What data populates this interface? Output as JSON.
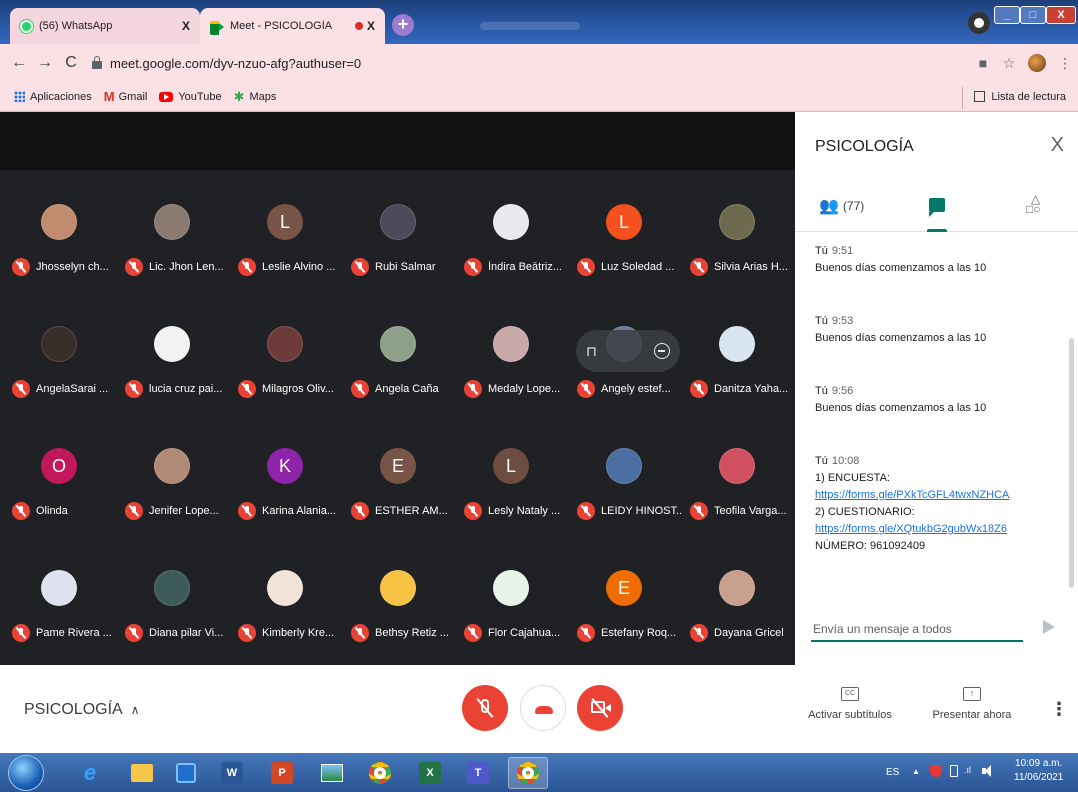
{
  "browser": {
    "tabs": [
      {
        "title": "(56) WhatsApp",
        "close": "X"
      },
      {
        "title": "Meet - PSICOLOGÍA",
        "close": "X"
      }
    ],
    "new_tab": "+",
    "url": "meet.google.com/dyv-nzuo-afg?authuser=0",
    "bookmarks": [
      "Aplicaciones",
      "Gmail",
      "YouTube",
      "Maps"
    ],
    "reading_list": "Lista de lectura",
    "window_buttons": {
      "minimize": "_",
      "maximize": "□",
      "close": "X"
    }
  },
  "participants": [
    {
      "name": "Jhosselyn ch...",
      "avatar": "",
      "color": "#c08b6e"
    },
    {
      "name": "Lic. Jhon Len...",
      "avatar": "",
      "color": "#8a7a70"
    },
    {
      "name": "Leslie Alvino ...",
      "avatar": "L",
      "color": "#795548"
    },
    {
      "name": "Rubi Salmar",
      "avatar": "",
      "color": "#4a4a5a"
    },
    {
      "name": "Índira Beātriz...",
      "avatar": "",
      "color": "#e8e8ee"
    },
    {
      "name": "Luz Soledad ...",
      "avatar": "L",
      "color": "#f4511e"
    },
    {
      "name": "Silvia Arias H...",
      "avatar": "",
      "color": "#6d6a4f"
    },
    {
      "name": "AngelaSarai ...",
      "avatar": "",
      "color": "#3a2e2a"
    },
    {
      "name": "lucia cruz pai...",
      "avatar": "",
      "color": "#f2f2f2"
    },
    {
      "name": "Milagros Oliv...",
      "avatar": "",
      "color": "#6e3b3b"
    },
    {
      "name": "Angela Caña",
      "avatar": "",
      "color": "#8fa08a"
    },
    {
      "name": "Medaly Lope...",
      "avatar": "",
      "color": "#c9a8a8"
    },
    {
      "name": "Angely estef...",
      "avatar": "",
      "color": "#6a7a9a"
    },
    {
      "name": "Danitza Yaha...",
      "avatar": "",
      "color": "#d8e4f0"
    },
    {
      "name": "Olinda",
      "avatar": "O",
      "color": "#c2185b"
    },
    {
      "name": "Jenifer Lope...",
      "avatar": "",
      "color": "#b08a74"
    },
    {
      "name": "Karina Alania...",
      "avatar": "K",
      "color": "#8e24aa"
    },
    {
      "name": "ESTHER AM...",
      "avatar": "E",
      "color": "#795548"
    },
    {
      "name": "Lesly Nataly ...",
      "avatar": "L",
      "color": "#6d4c41"
    },
    {
      "name": "LEIDY HINOST...",
      "avatar": "",
      "color": "#4a6fa0"
    },
    {
      "name": "Teofila Varga...",
      "avatar": "",
      "color": "#d05060"
    },
    {
      "name": "Pame Rivera ...",
      "avatar": "",
      "color": "#dde2ee"
    },
    {
      "name": "Diana pilar Vi...",
      "avatar": "",
      "color": "#3d5a5a"
    },
    {
      "name": "Kimberly Kre...",
      "avatar": "",
      "color": "#f2e3d8"
    },
    {
      "name": "Bethsy Retiz ...",
      "avatar": "",
      "color": "#f6c344"
    },
    {
      "name": "Flor Cajahua...",
      "avatar": "",
      "color": "#e8f4ea"
    },
    {
      "name": "Estefany Roq...",
      "avatar": "E",
      "color": "#ef6c00"
    },
    {
      "name": "Dayana Gricel",
      "avatar": "",
      "color": "#c9a08e"
    }
  ],
  "panel": {
    "title": "PSICOLOGÍA",
    "close": "X",
    "people_count": "(77)",
    "messages": [
      {
        "sender": "Tú",
        "time": "9:51",
        "lines": [
          "Buenos días comenzamos a las 10"
        ]
      },
      {
        "sender": "Tú",
        "time": "9:53",
        "lines": [
          "Buenos días comenzamos a las 10"
        ]
      },
      {
        "sender": "Tú",
        "time": "9:56",
        "lines": [
          "Buenos días comenzamos a las 10"
        ]
      },
      {
        "sender": "Tú",
        "time": "10:08",
        "lines": [
          "1)   ENCUESTA:",
          "https://forms.gle/PXkTcGFL4twxNZHCA",
          "2)   CUESTIONARIO:",
          "https://forms.gle/XQtukbG2gubWx18Z6",
          "NÚMERO: 961092409"
        ]
      }
    ],
    "compose_placeholder": "Envía un mensaje a todos"
  },
  "controls": {
    "meeting_name": "PSICOLOGÍA",
    "captions_label": "Activar subtítulos",
    "present_label": "Presentar ahora"
  },
  "taskbar": {
    "word": "W",
    "ppt": "P",
    "excel": "X",
    "teams": "T",
    "lang": "ES",
    "time": "10:09 a.m.",
    "date": "11/06/2021"
  }
}
